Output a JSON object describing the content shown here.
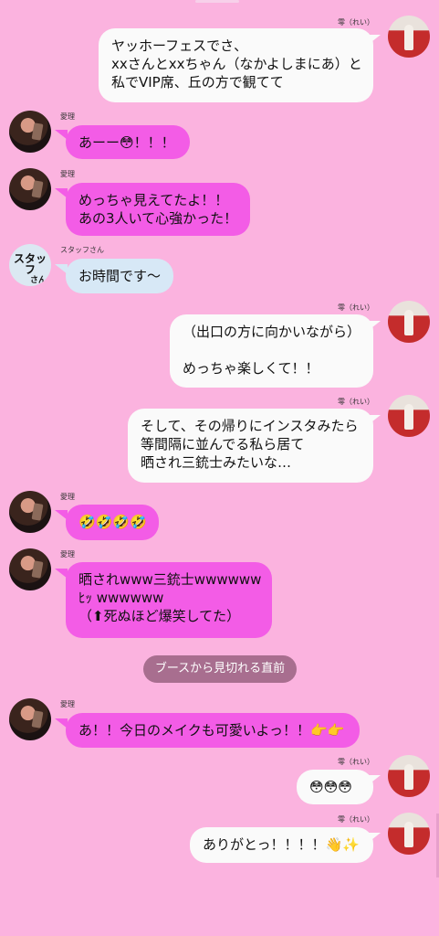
{
  "system_divider": "ブースから見切れる直前",
  "messages": [
    {
      "sender": "零（れい）",
      "text": "ヤッホーフェスでさ、\nxxさんとxxちゃん（なかよしまにあ）と\n私でVIP席、丘の方で観てて"
    },
    {
      "sender": "愛理",
      "text": "あーー😳！！！"
    },
    {
      "sender": "愛理",
      "text": "めっちゃ見えてたよ！！\nあの3人いて心強かった！"
    },
    {
      "sender": "スタッフさん",
      "text": "お時間です〜"
    },
    {
      "sender": "零（れい）",
      "text": "（出口の方に向かいながら）\n\nめっちゃ楽しくて！！"
    },
    {
      "sender": "零（れい）",
      "text": "そして、その帰りにインスタみたら\n等間隔に並んでる私ら居て\n晒され三銃士みたいな…"
    },
    {
      "sender": "愛理",
      "text": "🤣🤣🤣🤣"
    },
    {
      "sender": "愛理",
      "text": "晒されwww三銃士wwwwww\nﾋｯ wwwwww\n（⬆死ぬほど爆笑してた）"
    },
    {
      "sender": "愛理",
      "text": "あ！！今日のメイクも可愛いよっ！！👉👉"
    },
    {
      "sender": "零（れい）",
      "text": "😳😳😳"
    },
    {
      "sender": "零（れい）",
      "text": "ありがとっ！！！！👋✨"
    }
  ],
  "staff_logo": {
    "line1": "スタッフ",
    "line2": "さん"
  }
}
